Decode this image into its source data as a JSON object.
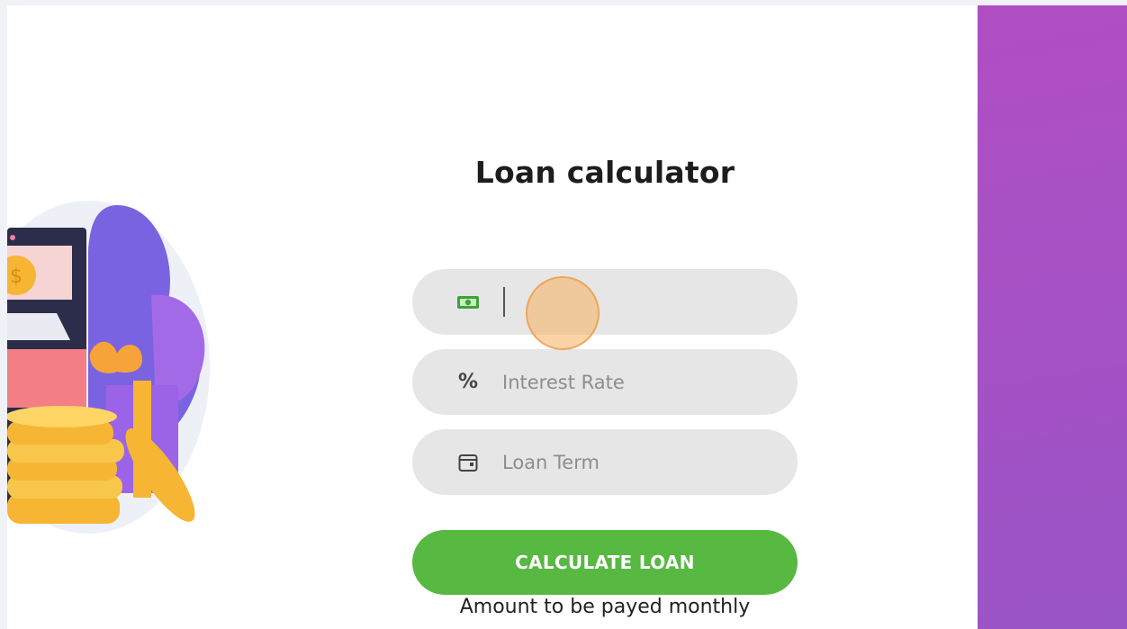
{
  "calculator": {
    "title": "Loan calculator",
    "amount_field": {
      "icon": "banknote-icon",
      "value": "",
      "placeholder": ""
    },
    "interest_field": {
      "icon": "percent-icon",
      "icon_glyph": "%",
      "value": "",
      "placeholder": "Interest Rate"
    },
    "term_field": {
      "icon": "calendar-icon",
      "value": "",
      "placeholder": "Loan Term"
    },
    "button_label": "CALCULATE LOAN",
    "result_label": "Amount to be payed monthly"
  },
  "colors": {
    "button_green": "#57b842",
    "field_bg": "#e6e6e6",
    "gradient_start": "#b14ec4",
    "gradient_end": "#9a55c7"
  }
}
